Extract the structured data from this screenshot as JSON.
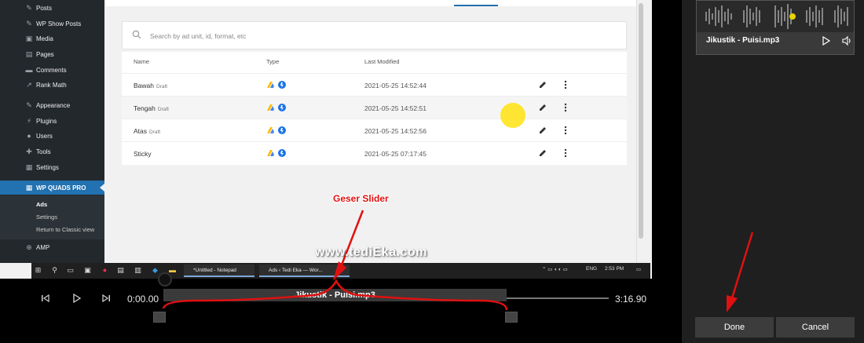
{
  "wp_menu": {
    "items": [
      "Posts",
      "WP Show Posts",
      "Media",
      "Pages",
      "Comments",
      "Rank Math",
      "Appearance",
      "Plugins",
      "Users",
      "Tools",
      "Settings"
    ],
    "active": "WP QUADS PRO",
    "sub_items": [
      "Ads",
      "Settings",
      "Return to Classic view"
    ],
    "after": "AMP"
  },
  "ads": {
    "search_placeholder": "Search by ad unit, id, format, etc",
    "columns": [
      "Name",
      "Type",
      "Last Modified"
    ],
    "draft_label": "Draft",
    "rows": [
      {
        "name": "Bawah",
        "draft": true,
        "modified": "2021-05-25 14:52:44"
      },
      {
        "name": "Tengah",
        "draft": true,
        "modified": "2021-05-25 14:52:51"
      },
      {
        "name": "Atas",
        "draft": true,
        "modified": "2021-05-25 14:52:56"
      },
      {
        "name": "Sticky",
        "draft": false,
        "modified": "2021-05-25 07:17:45"
      }
    ]
  },
  "taskbar": {
    "app1": "*Untitled - Notepad",
    "app2": "Ads ‹ Tedi Eka — Wor...",
    "lang": "ENG",
    "clock": "2:53 PM"
  },
  "player": {
    "time_start": "0:00.00",
    "time_end": "3:16.90",
    "track_title": "Jikustik - Puisi.mp3"
  },
  "thumbnail": {
    "title": "Jikustik - Puisi.mp3"
  },
  "buttons": {
    "done": "Done",
    "cancel": "Cancel"
  },
  "annotation": {
    "label": "Geser Slider",
    "watermark": "www.tediEka.com"
  },
  "colors": {
    "accent": "#2271b1",
    "annotation": "#e01010",
    "highlight": "#ffe100"
  }
}
